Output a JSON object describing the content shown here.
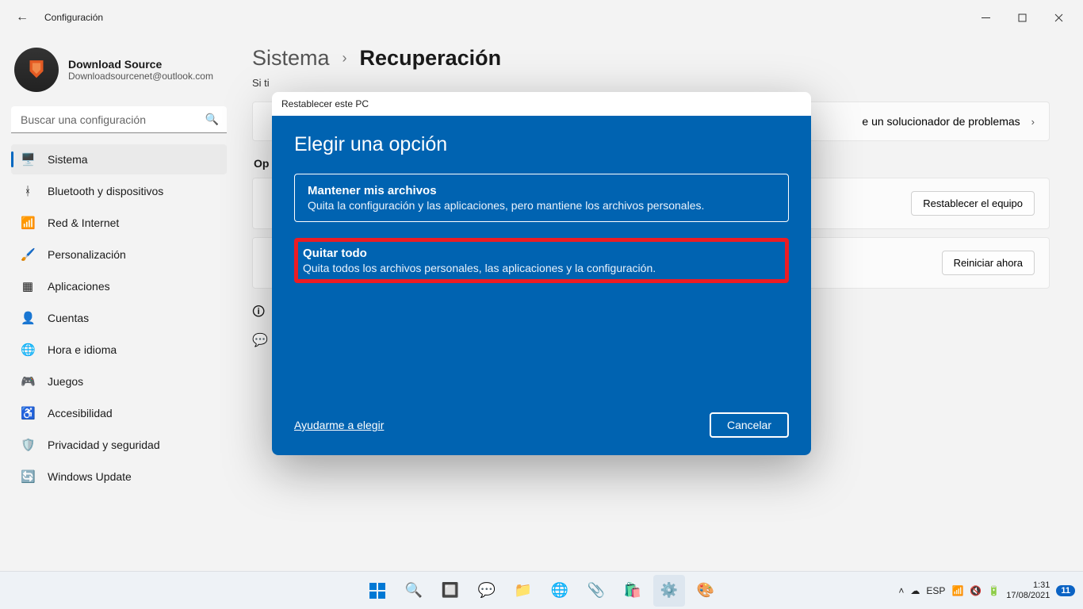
{
  "window": {
    "title": "Configuración"
  },
  "profile": {
    "name": "Download Source",
    "email": "Downloadsourcenet@outlook.com"
  },
  "search": {
    "placeholder": "Buscar una configuración"
  },
  "nav": [
    {
      "icon": "🖥️",
      "label": "Sistema",
      "active": true
    },
    {
      "icon": "ᚼ",
      "label": "Bluetooth y dispositivos"
    },
    {
      "icon": "📶",
      "label": "Red & Internet"
    },
    {
      "icon": "🖌️",
      "label": "Personalización"
    },
    {
      "icon": "▦",
      "label": "Aplicaciones"
    },
    {
      "icon": "👤",
      "label": "Cuentas"
    },
    {
      "icon": "🌐",
      "label": "Hora e idioma"
    },
    {
      "icon": "🎮",
      "label": "Juegos"
    },
    {
      "icon": "♿",
      "label": "Accesibilidad"
    },
    {
      "icon": "🛡️",
      "label": "Privacidad y seguridad"
    },
    {
      "icon": "🔄",
      "label": "Windows Update"
    }
  ],
  "breadcrumb": {
    "parent": "Sistema",
    "page": "Recuperación"
  },
  "subline": "Si ti",
  "cards": {
    "troubleshoot": {
      "text_tail": "e un solucionador de problemas"
    },
    "reset": {
      "action": "Restablecer el equipo"
    },
    "restart": {
      "action": "Reiniciar ahora"
    }
  },
  "section_head": "Op",
  "dialog": {
    "header": "Restablecer este PC",
    "title": "Elegir una opción",
    "opt1": {
      "title": "Mantener mis archivos",
      "desc": "Quita la configuración y las aplicaciones, pero mantiene los archivos personales."
    },
    "opt2": {
      "title": "Quitar todo",
      "desc": "Quita todos los archivos personales, las aplicaciones y la configuración."
    },
    "help": "Ayudarme a elegir",
    "cancel": "Cancelar"
  },
  "taskbar": {
    "lang": "ESP",
    "time": "1:31",
    "date": "17/08/2021",
    "badge": "11"
  }
}
